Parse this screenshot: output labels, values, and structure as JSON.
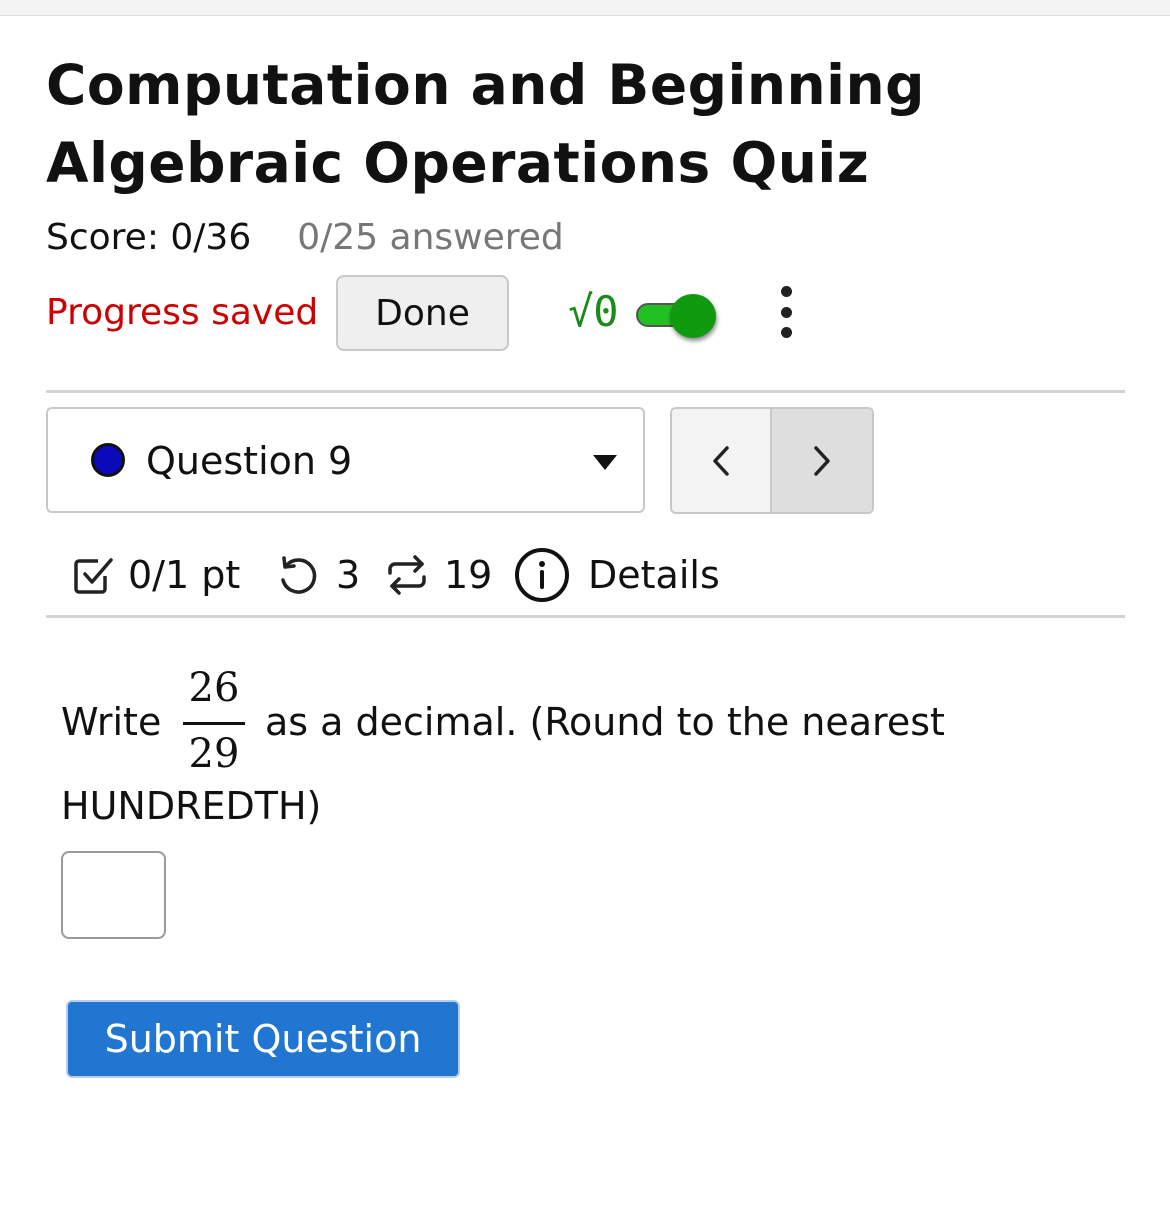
{
  "quiz": {
    "title": "Computation and Beginning Algebraic Operations Quiz",
    "score": "Score: 0/36",
    "answered": "0/25 answered",
    "progress_status": "Progress saved",
    "done_label": "Done",
    "math_toggle_symbol": "√0",
    "math_toggle_on": true
  },
  "question_nav": {
    "selected": "Question 9",
    "status_color": "#0a0ab8",
    "prev_icon": "chevron-left-icon",
    "next_icon": "chevron-right-icon"
  },
  "meta": {
    "points": "0/1 pt",
    "retries": "3",
    "versions": "19",
    "details_label": "Details"
  },
  "question": {
    "prefix": "Write",
    "numerator": "26",
    "denominator": "29",
    "suffix": "as a decimal. (Round to the nearest",
    "suffix_line2": "HUNDREDTH)",
    "answer_value": ""
  },
  "submit_label": "Submit Question",
  "colors": {
    "accent": "#2176d2",
    "progress_saved": "#cc0000",
    "toggle_on": "#0f9a0f"
  }
}
